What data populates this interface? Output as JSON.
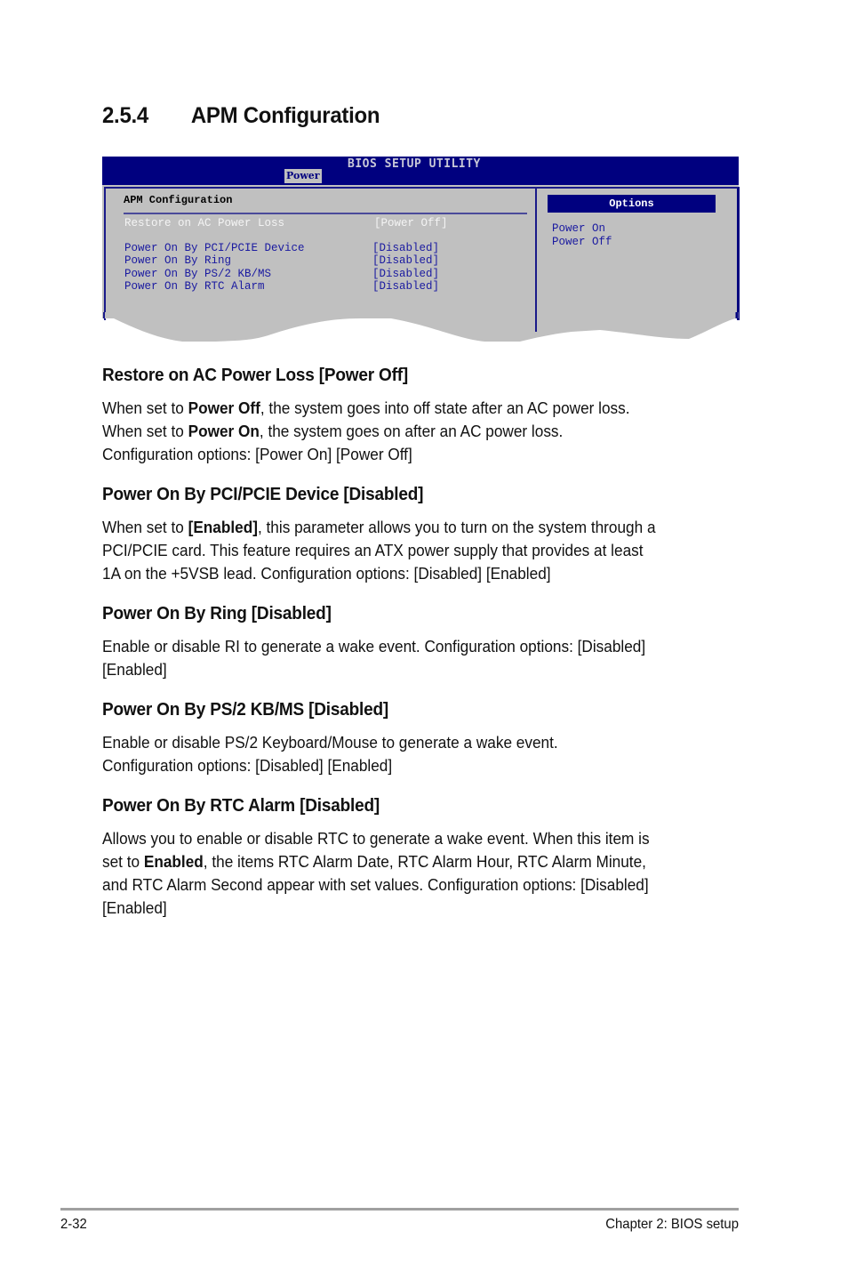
{
  "section": {
    "number": "2.5.4",
    "title": "APM Configuration"
  },
  "bios": {
    "title": "BIOS SETUP UTILITY",
    "active_tab": "Power",
    "panel_heading": "APM Configuration",
    "items": [
      {
        "label": "Restore on AC Power Loss",
        "value": "[Power Off]",
        "selected": true
      },
      {
        "label": "Power On By PCI/PCIE Device",
        "value": "[Disabled]"
      },
      {
        "label": "Power On By Ring",
        "value": "[Disabled]"
      },
      {
        "label": "Power On By PS/2 KB/MS",
        "value": "[Disabled]"
      },
      {
        "label": "Power On By RTC Alarm",
        "value": "[Disabled]"
      }
    ],
    "options_heading": "Options",
    "options": [
      "Power On",
      "Power Off"
    ],
    "colors": {
      "header": "#00007f",
      "panel": "#c0c0c0",
      "item_text": "#1a1aa0",
      "selected_text": "#f4f4f4"
    }
  },
  "sections": [
    {
      "heading": "Restore on AC Power Loss [Power Off]",
      "lines": [
        [
          "When set to ",
          {
            "b": "Power Off"
          },
          ", the system goes into off state after an AC power loss."
        ],
        [
          "When set to ",
          {
            "b": "Power On"
          },
          ", the system goes on after an AC power loss."
        ],
        [
          "Configuration options: [Power On] [Power Off]"
        ]
      ]
    },
    {
      "heading": "Power On By PCI/PCIE Device [Disabled]",
      "lines": [
        [
          "When set to ",
          {
            "b": "[Enabled]"
          },
          ", this parameter allows you to turn on the system through a"
        ],
        [
          "PCI/PCIE card. This feature requires an ATX power supply that provides at least"
        ],
        [
          "1A on the +5VSB lead. Configuration options: [Disabled] [Enabled]"
        ]
      ]
    },
    {
      "heading": "Power On By Ring [Disabled]",
      "lines": [
        [
          "Enable or disable RI to generate a wake event. Configuration options: [Disabled]"
        ],
        [
          "[Enabled]"
        ]
      ]
    },
    {
      "heading": "Power On By PS/2 KB/MS [Disabled]",
      "lines": [
        [
          "Enable or disable PS/2 Keyboard/Mouse to generate a wake event."
        ],
        [
          "Configuration options: [Disabled] [Enabled]"
        ]
      ]
    },
    {
      "heading": "Power On By RTC Alarm [Disabled]",
      "lines": [
        [
          "Allows you to enable or disable RTC to generate a wake event. When this item is"
        ],
        [
          "set to ",
          {
            "b": "Enabled"
          },
          ", the items RTC Alarm Date, RTC Alarm Hour, RTC Alarm Minute,"
        ],
        [
          "and RTC Alarm Second appear with set values. Configuration options: [Disabled]"
        ],
        [
          "[Enabled]"
        ]
      ]
    }
  ],
  "footer": {
    "page": "2-32",
    "chapter": "Chapter 2: BIOS setup"
  }
}
